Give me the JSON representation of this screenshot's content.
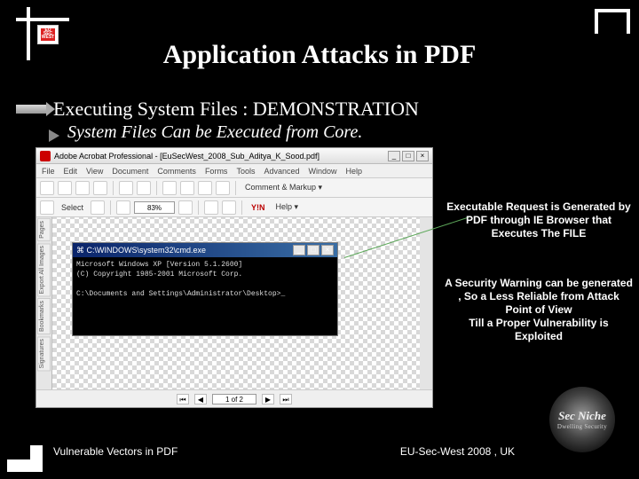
{
  "title": "Application Attacks in PDF",
  "subtitle1": "Executing System Files : DEMONSTRATION",
  "subtitle2": "System Files Can be Executed from Core.",
  "small_logo": "EU SEC WEST",
  "acrobat": {
    "window_title": "Adobe Acrobat Professional - [EuSecWest_2008_Sub_Aditya_K_Sood.pdf]",
    "menus": [
      "File",
      "Edit",
      "View",
      "Document",
      "Comments",
      "Forms",
      "Tools",
      "Advanced",
      "Window",
      "Help"
    ],
    "toolbar2": {
      "select_label": "Select",
      "zoom": "83%",
      "yn": "Y!N",
      "help": "Help ▾",
      "comment": "Comment & Markup ▾"
    },
    "side_tabs": [
      "Pages",
      "Export All Images",
      "Bookmarks",
      "Signatures"
    ],
    "pager": "1 of 2",
    "win_btns": {
      "min": "_",
      "max": "□",
      "close": "×"
    }
  },
  "cmd": {
    "title_icon": "⌘",
    "title": "C:\\WINDOWS\\system32\\cmd.exe",
    "line1": "Microsoft Windows XP [Version 5.1.2600]",
    "line2": "(C) Copyright 1985-2001 Microsoft Corp.",
    "prompt": "C:\\Documents and Settings\\Administrator\\Desktop>_",
    "btns": {
      "min": "_",
      "max": "□",
      "close": "×"
    }
  },
  "callout1": "Executable Request is Generated by PDF through IE Browser that Executes The FILE",
  "callout2": "A Security Warning can be generated , So a Less Reliable from Attack Point of View\nTill a Proper Vulnerability is Exploited",
  "brand": {
    "name": "Sec Niche",
    "tagline": "Dwelling Security"
  },
  "footer_left": "Vulnerable Vectors in PDF",
  "footer_right": "EU-Sec-West 2008 , UK"
}
